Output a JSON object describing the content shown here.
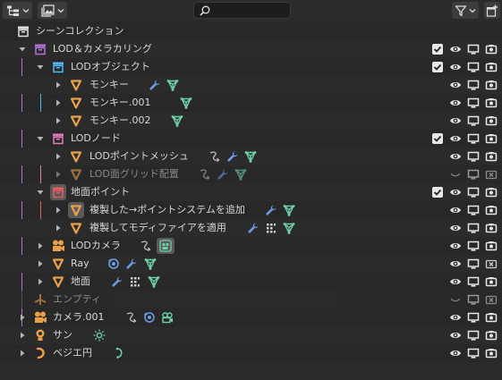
{
  "search": {
    "placeholder": ""
  },
  "colors": {
    "collection_purple": "#b072d0",
    "collection_blue": "#4fb7f5",
    "collection_pink": "#e07ab8",
    "collection_red": "#e35d5d",
    "mesh_orange": "#e8a04a",
    "modifier_blue": "#6f9ce8",
    "data_green": "#6fd0a8"
  },
  "rows": [
    {
      "label": "シーンコレクション"
    },
    {
      "label": "LOD＆カメラカリング"
    },
    {
      "label": "LODオブジェクト"
    },
    {
      "label": "モンキー"
    },
    {
      "label": "モンキー.001"
    },
    {
      "label": "モンキー.002"
    },
    {
      "label": "LODノード"
    },
    {
      "label": "LODポイントメッシュ"
    },
    {
      "label": "LOD面グリッド配置"
    },
    {
      "label": "地面ポイント"
    },
    {
      "label": "複製した→ポイントシステムを追加"
    },
    {
      "label": "複製してモディファイアを適用"
    },
    {
      "label": "LODカメラ"
    },
    {
      "label": "Ray"
    },
    {
      "label": "地面"
    },
    {
      "label": "エンプティ"
    },
    {
      "label": "カメラ.001"
    },
    {
      "label": "サン"
    },
    {
      "label": "ベジエ円"
    }
  ]
}
